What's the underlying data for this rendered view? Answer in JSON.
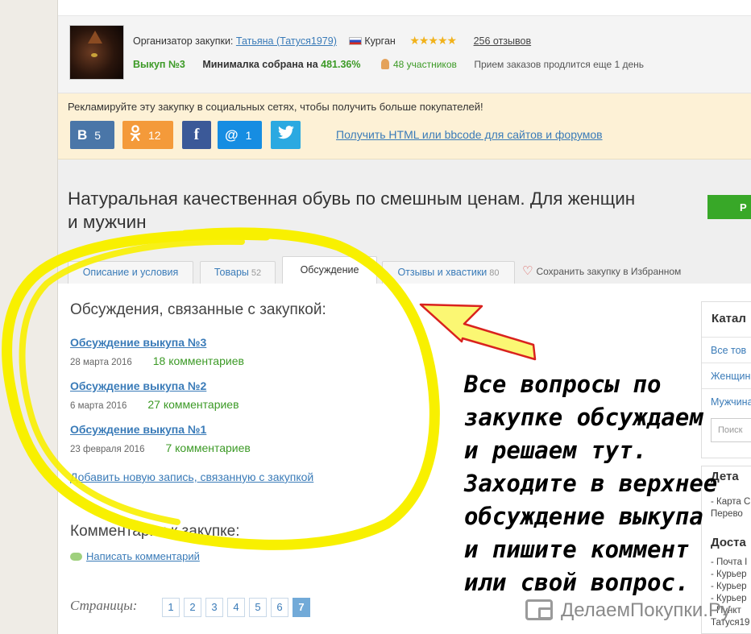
{
  "organizer": {
    "label": "Организатор закупки:",
    "name": "Татьяна (Татуся1979)",
    "city": "Курган",
    "stars": "★★★★★",
    "reviews": "256 отзывов",
    "vykup": "Выкуп №3",
    "minimal_label": "Минималка собрана на",
    "minimal_pct": "481.36%",
    "members": "48 участников",
    "deadline": "Прием заказов продлится еще 1 день"
  },
  "share": {
    "text": "Рекламируйте эту закупку в социальных сетях, чтобы получить больше покупателей!",
    "vk_icon": "В",
    "vk_count": "5",
    "ok_icon": "ok",
    "ok_count": "12",
    "fb_icon": "f",
    "mr_icon": "@",
    "mr_count": "1",
    "tw_icon": "twitter",
    "html_link": "Получить HTML или bbcode для сайтов и форумов"
  },
  "title": "Натуральная качественная обувь по смешным ценам. Для женщин и мужчин",
  "green_button": "Р",
  "tabs": [
    {
      "label": "Описание и условия",
      "count": ""
    },
    {
      "label": "Товары",
      "count": "52"
    },
    {
      "label": "Обсуждение",
      "count": ""
    },
    {
      "label": "Отзывы и хвастики",
      "count": "80"
    }
  ],
  "favorite": "Сохранить закупку в Избранном",
  "discussions": {
    "heading": "Обсуждения, связанные с закупкой:",
    "items": [
      {
        "title": "Обсуждение выкупа №3",
        "date": "28 марта 2016",
        "comments": "18 комментариев"
      },
      {
        "title": "Обсуждение выкупа №2",
        "date": "6 марта 2016",
        "comments": "27 комментариев"
      },
      {
        "title": "Обсуждение выкупа №1",
        "date": "23 февраля 2016",
        "comments": "7 комментариев"
      }
    ],
    "add_link": "Добавить новую запись, связанную с закупкой"
  },
  "comments": {
    "heading": "Комментарии к закупке:",
    "write": "Написать комментарий"
  },
  "pages": {
    "label": "Страницы:",
    "items": [
      "1",
      "2",
      "3",
      "4",
      "5",
      "6",
      "7"
    ],
    "current": "7"
  },
  "sidebar": {
    "catalog_heading": "Катал",
    "items": [
      "Все тов",
      "Женщин",
      "Мужчина"
    ],
    "search_placeholder": "Поиск",
    "block2_heading": "Дета",
    "block2_lines": [
      "- Карта С",
      "Перево"
    ],
    "delivery_heading": "Доста",
    "delivery_lines": [
      "- Почта I",
      "- Курьер",
      "- Курьер",
      "- Курьер",
      "- Пункт",
      "Татуся19"
    ]
  },
  "annotation": "Все вопросы по\nзакупке обсуждаем\nи решаем тут.\nЗаходите в верхнее\nобсуждение выкупа\nи пишите коммент\nили свой вопрос.",
  "watermark": "ДелаемПокупки.Ру",
  "colors": {
    "highlight": "#f8f000",
    "arrow": "#d9221e",
    "link": "#3a7bb8",
    "green": "#3c9a26"
  }
}
